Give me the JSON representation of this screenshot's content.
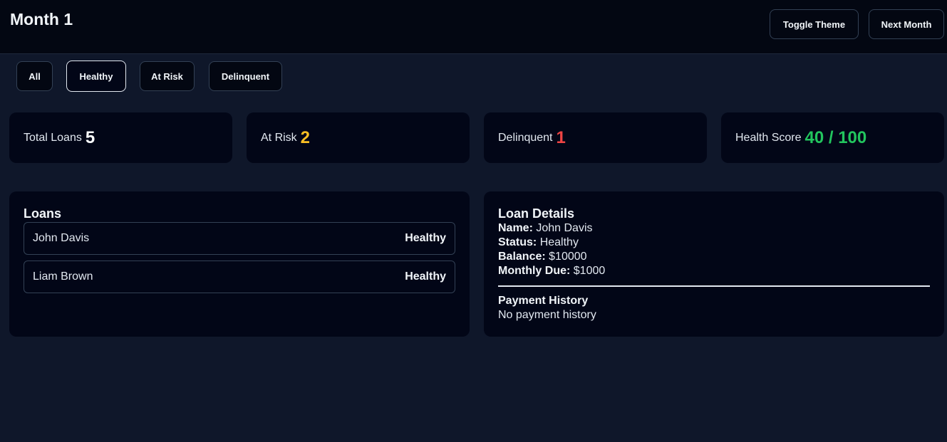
{
  "header": {
    "title": "Month 1",
    "toggle_theme_label": "Toggle Theme",
    "next_month_label": "Next Month"
  },
  "filters": [
    {
      "label": "All",
      "active": false
    },
    {
      "label": "Healthy",
      "active": true
    },
    {
      "label": "At Risk",
      "active": false
    },
    {
      "label": "Delinquent",
      "active": false
    }
  ],
  "stats": {
    "total_loans": {
      "label": "Total Loans",
      "value": "5",
      "color": "#f8fafc"
    },
    "at_risk": {
      "label": "At Risk",
      "value": "2",
      "color": "#fbbf24"
    },
    "delinquent": {
      "label": "Delinquent",
      "value": "1",
      "color": "#ef4444"
    },
    "health_score": {
      "label": "Health Score",
      "value": "40 / 100",
      "color": "#22c55e"
    }
  },
  "loans_panel": {
    "title": "Loans",
    "items": [
      {
        "name": "John Davis",
        "status": "Healthy"
      },
      {
        "name": "Liam Brown",
        "status": "Healthy"
      }
    ]
  },
  "details_panel": {
    "title": "Loan Details",
    "name_label": "Name:",
    "name_value": "John Davis",
    "status_label": "Status:",
    "status_value": "Healthy",
    "balance_label": "Balance:",
    "balance_value": "$10000",
    "monthly_due_label": "Monthly Due:",
    "monthly_due_value": "$1000",
    "payment_history_title": "Payment History",
    "payment_history_empty": "No payment history"
  }
}
